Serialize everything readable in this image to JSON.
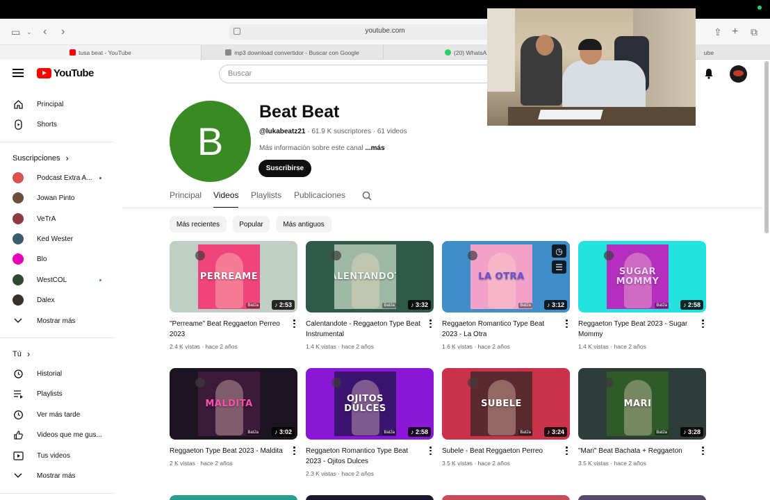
{
  "browser": {
    "url": "youtube.com",
    "tabs": [
      {
        "label": "tusa beat - YouTube",
        "color": "#ff0000"
      },
      {
        "label": "mp3 download convertidor - Buscar con Google",
        "color": "#888888"
      },
      {
        "label": "(20) WhatsA",
        "color": "#25d366"
      },
      {
        "label": "ube",
        "color": "#ff0000"
      }
    ]
  },
  "header": {
    "logo_text": "YouTube",
    "search_placeholder": "Buscar"
  },
  "sidebar": {
    "main": [
      {
        "label": "Principal",
        "icon": "home-icon"
      },
      {
        "label": "Shorts",
        "icon": "shorts-icon"
      }
    ],
    "subs_heading": "Suscripciones",
    "subscriptions": [
      {
        "label": "Podcast Extra A...",
        "color": "#d9534f",
        "live": true
      },
      {
        "label": "Jowan Pinto",
        "color": "#6b4f3a",
        "live": false
      },
      {
        "label": "VeTrA",
        "color": "#8e3b46",
        "live": false
      },
      {
        "label": "Ked Wester",
        "color": "#3a5b6b",
        "live": false
      },
      {
        "label": "Blo",
        "color": "#e600b8",
        "live": false
      },
      {
        "label": "WestCOL",
        "color": "#2e4a2e",
        "live": true
      },
      {
        "label": "Dalex",
        "color": "#3c2f2a",
        "live": false
      }
    ],
    "show_more_1": "Mostrar más",
    "you_heading": "Tú",
    "you_items": [
      {
        "label": "Historial",
        "icon": "history-icon"
      },
      {
        "label": "Playlists",
        "icon": "playlists-icon"
      },
      {
        "label": "Ver más tarde",
        "icon": "watch-later-icon"
      },
      {
        "label": "Videos que me gus...",
        "icon": "like-icon"
      },
      {
        "label": "Tus videos",
        "icon": "your-videos-icon"
      }
    ],
    "show_more_2": "Mostrar más"
  },
  "channel": {
    "avatar_letter": "B",
    "avatar_color": "#3a8a24",
    "name": "Beat Beat",
    "handle": "@lukabeatz21",
    "stats": "· 61.9 K suscriptores · 61 videos",
    "desc": "Más información sobre este canal",
    "desc_more": "...más",
    "subscribe_label": "Suscribirse",
    "tabs": [
      "Principal",
      "Videos",
      "Playlists",
      "Publicaciones"
    ],
    "active_tab": "Videos"
  },
  "chips": [
    "Más recientes",
    "Popular",
    "Más antiguos"
  ],
  "videos": [
    {
      "title": "\"Perreame\" Beat Reggaeton Perreo 2023",
      "views": "2.4 K vistas",
      "age": "hace 2 años",
      "duration": "♪ 2:53",
      "art": "PERREAME",
      "bg": "#bfcfc4",
      "art_bg": "#f0457a",
      "art_color": "#ffffff"
    },
    {
      "title": "Calentandote - Reggaeton Type Beat Instrumental",
      "views": "1.4 K vistas",
      "age": "hace 2 años",
      "duration": "♪ 3:32",
      "art": "CALENTANDOTE",
      "bg": "#2f5a48",
      "art_bg": "#9fb8a5",
      "art_color": "#e8f5ee"
    },
    {
      "title": "Reggaeton Romantico Type Beat 2023 - La Otra",
      "views": "1.6 K vistas",
      "age": "hace 2 años",
      "duration": "♪ 3:12",
      "art": "LA OTRA",
      "bg": "#3f8ec9",
      "art_bg": "#f2a2c8",
      "art_color": "#6a4fd9"
    },
    {
      "title": "Reggaeton Type Beat 2023 - Sugar Mommy",
      "views": "1.4 K vistas",
      "age": "hace 2 años",
      "duration": "♪ 2:58",
      "art": "SUGAR MOMMY",
      "bg": "#24e3df",
      "art_bg": "#b52fbf",
      "art_color": "#f3d2ff"
    },
    {
      "title": "Reggaeton Type Beat 2023 - Maldita",
      "views": "2 K vistas",
      "age": "hace 2 años",
      "duration": "♪ 3:02",
      "art": "MALDITA",
      "bg": "#1c1420",
      "art_bg": "#3c1a3a",
      "art_color": "#ff4fb0"
    },
    {
      "title": "Reggaeton Romantico Type Beat 2023 - Ojitos Dulces",
      "views": "2.3 K vistas",
      "age": "hace 2 años",
      "duration": "♪ 2:58",
      "art": "OJITOS DULCES",
      "bg": "#8a17d6",
      "art_bg": "#3b1470",
      "art_color": "#ffffff"
    },
    {
      "title": "Subele - Beat Reggaeton Perreo",
      "views": "3.5 K vistas",
      "age": "hace 2 años",
      "duration": "♪ 3:24",
      "art": "SUBELE",
      "bg": "#c9324a",
      "art_bg": "#5a2a2e",
      "art_color": "#ffffff"
    },
    {
      "title": "\"Mari\" Beat Bachata + Reggaeton",
      "views": "3.5 K vistas",
      "age": "hace 2 años",
      "duration": "♪ 3:28",
      "art": "MARI",
      "bg": "#2e3d3a",
      "art_bg": "#2f5a2a",
      "art_color": "#ffffff"
    }
  ],
  "thumb_watermark": "Bat2a",
  "third_row_colors": [
    "#2a9d8f",
    "#1a1a2a",
    "#c94c5a",
    "#5a4a6a"
  ]
}
